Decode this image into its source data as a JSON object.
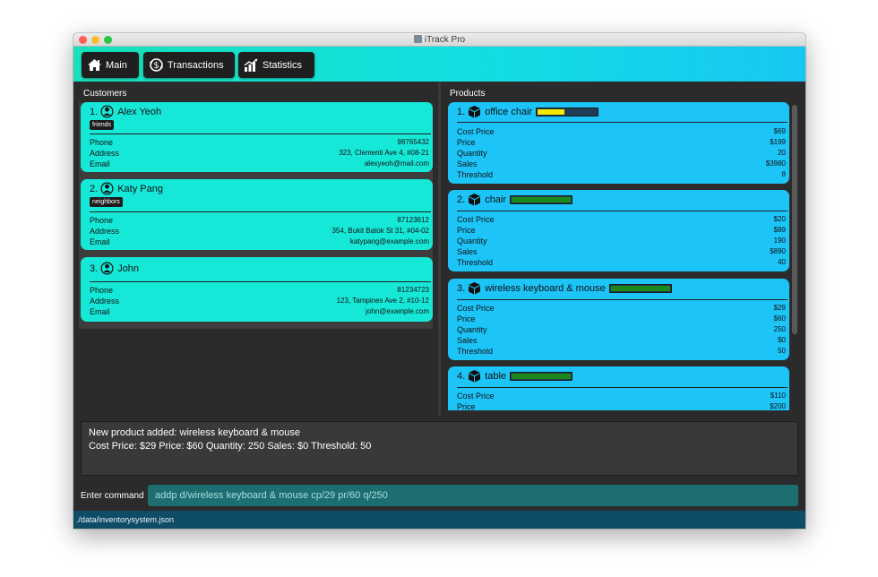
{
  "window": {
    "title": "iTrack Pro"
  },
  "toolbar": {
    "buttons": [
      {
        "label": "Main",
        "icon": "home-icon"
      },
      {
        "label": "Transactions",
        "icon": "dollar-cycle-icon"
      },
      {
        "label": "Statistics",
        "icon": "bar-chart-icon"
      }
    ]
  },
  "customers": {
    "heading": "Customers",
    "items": [
      {
        "index": "1.",
        "name": "Alex Yeoh",
        "tag": "friends",
        "fields": [
          {
            "label": "Phone",
            "value": "98765432"
          },
          {
            "label": "Address",
            "value": "323, Clementi Ave 4, #08-21"
          },
          {
            "label": "Email",
            "value": "alexyeoh@mail.com"
          }
        ]
      },
      {
        "index": "2.",
        "name": "Katy Pang",
        "tag": "neighbors",
        "fields": [
          {
            "label": "Phone",
            "value": "87123612"
          },
          {
            "label": "Address",
            "value": "354, Bukit Batok St 31, #04-02"
          },
          {
            "label": "Email",
            "value": "katypang@example.com"
          }
        ]
      },
      {
        "index": "3.",
        "name": "John",
        "tag": "",
        "fields": [
          {
            "label": "Phone",
            "value": "81234723"
          },
          {
            "label": "Address",
            "value": "123, Tampines Ave 2, #10-12"
          },
          {
            "label": "Email",
            "value": "john@example.com"
          }
        ]
      }
    ]
  },
  "products": {
    "heading": "Products",
    "items": [
      {
        "index": "1.",
        "name": "office chair",
        "stock_level": 0.45,
        "stock_color": "#f2ea00",
        "fields": [
          {
            "label": "Cost Price",
            "value": "$69"
          },
          {
            "label": "Price",
            "value": "$199"
          },
          {
            "label": "Quantity",
            "value": "20"
          },
          {
            "label": "Sales",
            "value": "$3980"
          },
          {
            "label": "Threshold",
            "value": "8"
          }
        ]
      },
      {
        "index": "2.",
        "name": "chair",
        "stock_level": 1.0,
        "stock_color": "#1b8a1b",
        "fields": [
          {
            "label": "Cost Price",
            "value": "$20"
          },
          {
            "label": "Price",
            "value": "$89"
          },
          {
            "label": "Quantity",
            "value": "190"
          },
          {
            "label": "Sales",
            "value": "$890"
          },
          {
            "label": "Threshold",
            "value": "40"
          }
        ]
      },
      {
        "index": "3.",
        "name": "wireless keyboard & mouse",
        "stock_level": 1.0,
        "stock_color": "#1b8a1b",
        "fields": [
          {
            "label": "Cost Price",
            "value": "$29"
          },
          {
            "label": "Price",
            "value": "$60"
          },
          {
            "label": "Quantity",
            "value": "250"
          },
          {
            "label": "Sales",
            "value": "$0"
          },
          {
            "label": "Threshold",
            "value": "50"
          }
        ]
      },
      {
        "index": "4.",
        "name": "table",
        "stock_level": 1.0,
        "stock_color": "#1b8a1b",
        "fields": [
          {
            "label": "Cost Price",
            "value": "$110"
          },
          {
            "label": "Price",
            "value": "$200"
          }
        ]
      }
    ]
  },
  "result": {
    "line1": "New product added: wireless keyboard & mouse",
    "line2": "Cost Price: $29 Price: $60 Quantity: 250 Sales: $0 Threshold: 50"
  },
  "command": {
    "label": "Enter command",
    "value": "addp d/wireless keyboard & mouse cp/29 pr/60 q/250"
  },
  "status": {
    "path": "./data/inventorysystem.json"
  }
}
